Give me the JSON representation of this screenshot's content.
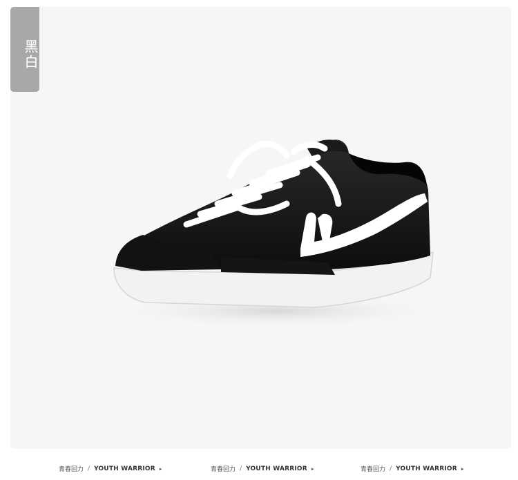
{
  "image": {
    "subject": "sneaker-photo",
    "background_color": "#f6f6f6"
  },
  "color_tag": {
    "label": "黑白",
    "background": "#a8a8a8"
  },
  "footer": {
    "items": [
      {
        "cn": "青春回力",
        "sep": "/",
        "en": "YOUTH WARRIOR",
        "arrow": "▸"
      },
      {
        "cn": "青春回力",
        "sep": "/",
        "en": "YOUTH WARRIOR",
        "arrow": "▸"
      },
      {
        "cn": "青春回力",
        "sep": "/",
        "en": "YOUTH WARRIOR",
        "arrow": "▸"
      }
    ]
  }
}
